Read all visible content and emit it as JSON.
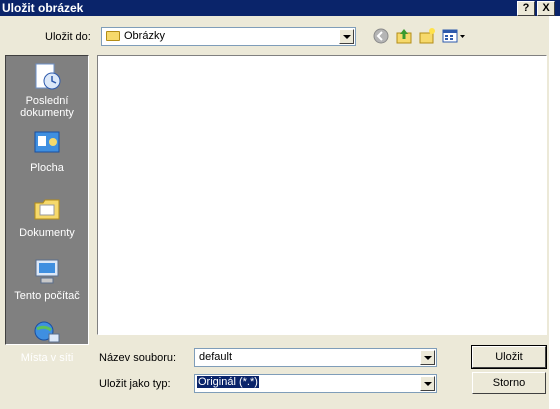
{
  "window": {
    "title": "Uložit obrázek",
    "help_label": "?",
    "close_label": "X"
  },
  "save_in": {
    "label": "Uložit do:",
    "value": "Obrázky"
  },
  "places": [
    {
      "label": "Poslední dokumenty",
      "icon": "recent-documents-icon"
    },
    {
      "label": "Plocha",
      "icon": "desktop-icon"
    },
    {
      "label": "Dokumenty",
      "icon": "documents-folder-icon"
    },
    {
      "label": "Tento počítač",
      "icon": "my-computer-icon"
    },
    {
      "label": "Místa v síti",
      "icon": "network-places-icon"
    }
  ],
  "filename": {
    "label": "Název souboru:",
    "value": "default"
  },
  "filetype": {
    "label": "Uložit jako typ:",
    "value": "Originál (*.*)"
  },
  "buttons": {
    "save": "Uložit",
    "cancel": "Storno"
  },
  "colors": {
    "titlebar": "#0A246A",
    "dialog_bg": "#ECE9D8",
    "places_bg": "#808080"
  }
}
